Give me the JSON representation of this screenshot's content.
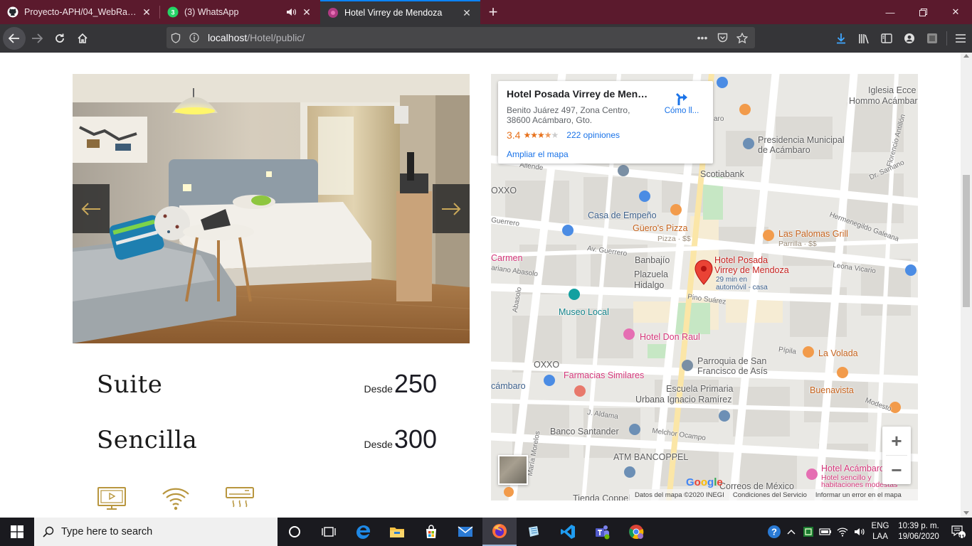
{
  "browser": {
    "tabs": [
      {
        "title": "Proyecto-APH/04_WebRabbit a",
        "icon": "github-icon"
      },
      {
        "title": "(3) WhatsApp",
        "icon": "whatsapp-icon",
        "audio": true
      },
      {
        "title": "Hotel Virrey de Mendoza",
        "icon": "hotel-favicon-icon",
        "active": true
      }
    ],
    "url_host": "localhost",
    "url_path": "/Hotel/public/"
  },
  "room": {
    "rows": [
      {
        "name": "Suite",
        "desde": "Desde",
        "price": "250"
      },
      {
        "name": "Sencilla",
        "desde": "Desde",
        "price": "300"
      }
    ],
    "amenities": [
      "tv-icon",
      "wifi-icon",
      "air-conditioner-icon"
    ],
    "accent_color": "#b8963e"
  },
  "map": {
    "place_title": "Hotel Posada Virrey de Mendo...",
    "address_line1": "Benito Juárez 497, Zona Centro,",
    "address_line2": "38600 Acámbaro, Gto.",
    "rating": "3.4",
    "stars": "★★★★★",
    "reviews": "222 opiniones",
    "enlarge": "Ampliar el mapa",
    "directions": "Cómo ll...",
    "marker_label1": "Hotel Posada",
    "marker_label2": "Virrey de Mendoza",
    "marker_sub1": "29 min en",
    "marker_sub2": "automóvil - casa",
    "labels": {
      "iglesia1": "Iglesia Ecce",
      "iglesia2": "Hommo Acámbaro",
      "presidencia1": "Presidencia Municipal",
      "presidencia2": "de Acámbaro",
      "scotiabank": "Scotiabank",
      "oxxo1": "OXXO",
      "casa_empeno": "Casa de Empeño",
      "gueros1": "Güero's Pizza",
      "gueros2": "Pizza · $$",
      "palomas1": "Las Palomas Grill",
      "palomas2": "Parrilla · $$",
      "carmen": "Carmen",
      "banbajio": "Banbajío",
      "plazuela1": "Plazuela",
      "plazuela2": "Hidalgo",
      "museo": "Museo Local",
      "don_raul": "Hotel Don Raul",
      "oxxo2": "OXXO",
      "farmacias": "Farmacias Similares",
      "parroquia1": "Parroquia de San",
      "parroquia2": "Francisco de Asís",
      "volada": "La Volada",
      "buenavista": "Buenavista",
      "cambaro": "cámbaro",
      "escuela1": "Escuela Primaria",
      "escuela2": "Urbana Ignacio Ramírez",
      "santander": "Banco Santander",
      "bancoppel": "ATM BANCOPPEL",
      "acambaro1": "Hotel Acámbaro",
      "acambaro2": "Hotel sencillo y",
      "acambaro3": "habitaciones modestas",
      "correos": "Correos de México",
      "tienda": "Tienda Coppel",
      "st_allende": "Allende",
      "st_guerrero1": "Guerrero",
      "st_guerrero2": "Av. Guerrero",
      "st_abasolo1": "ariano Abasolo",
      "st_abasolo2": "Abasolo",
      "st_pino": "Pino Suárez",
      "st_pipila": "Pípila",
      "st_aldama": "J. Aldama",
      "st_melchor": "Melchor Ocampo",
      "st_morelos": "María Morelos",
      "st_hermenegildo": "Hermenegildo Galeana",
      "st_leona": "Leona Vicario",
      "st_samano": "Dr. Samano",
      "st_florencio": "Florencio Antillón",
      "st_modesto": "Modesto",
      "st_aro": "aro"
    },
    "footer_data": "Datos del mapa ©2020 INEGI",
    "footer_terms": "Condiciones del Servicio",
    "footer_report": "Informar un error en el mapa",
    "google": "Google"
  },
  "taskbar": {
    "search_placeholder": "Type here to search",
    "lang1": "ENG",
    "lang2": "LAA",
    "time": "10:39 p. m.",
    "date": "19/06/2020",
    "notif_count": "11"
  }
}
